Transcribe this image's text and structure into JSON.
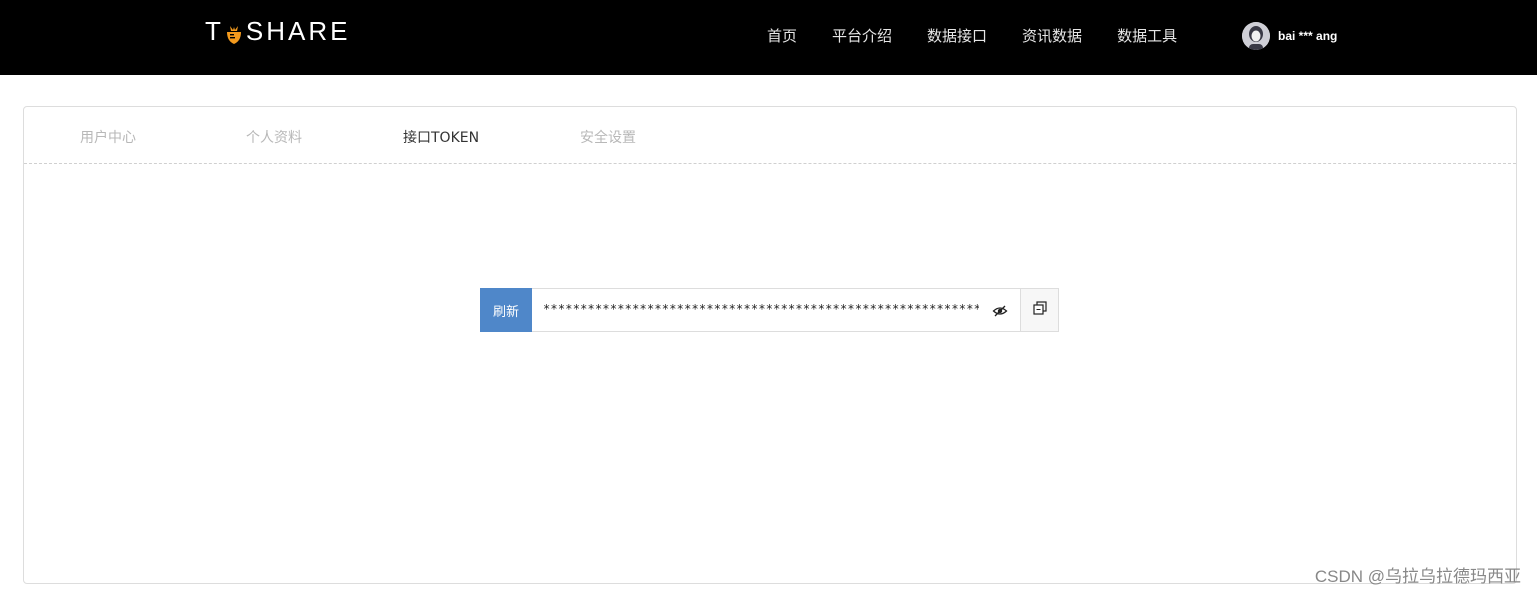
{
  "header": {
    "logo_text_left": "T",
    "logo_text_right": "SHARE",
    "nav": [
      {
        "label": "首页"
      },
      {
        "label": "平台介绍"
      },
      {
        "label": "数据接口"
      },
      {
        "label": "资讯数据"
      },
      {
        "label": "数据工具"
      }
    ],
    "user": {
      "name": "bai *** ang"
    }
  },
  "tabs": [
    {
      "label": "用户中心",
      "active": false
    },
    {
      "label": "个人资料",
      "active": false
    },
    {
      "label": "接口TOKEN",
      "active": true
    },
    {
      "label": "安全设置",
      "active": false
    }
  ],
  "token": {
    "refresh_label": "刷新",
    "value": "****************************************************************",
    "eye_icon": "eye-slash-icon",
    "copy_icon": "copy-icon"
  },
  "watermark": "CSDN @乌拉乌拉德玛西亚",
  "colors": {
    "header_bg": "#000000",
    "refresh_bg": "#4f87c9",
    "tab_active": "#333333",
    "tab_inactive": "#b8b8b8",
    "logo_accent": "#f39a1d"
  }
}
